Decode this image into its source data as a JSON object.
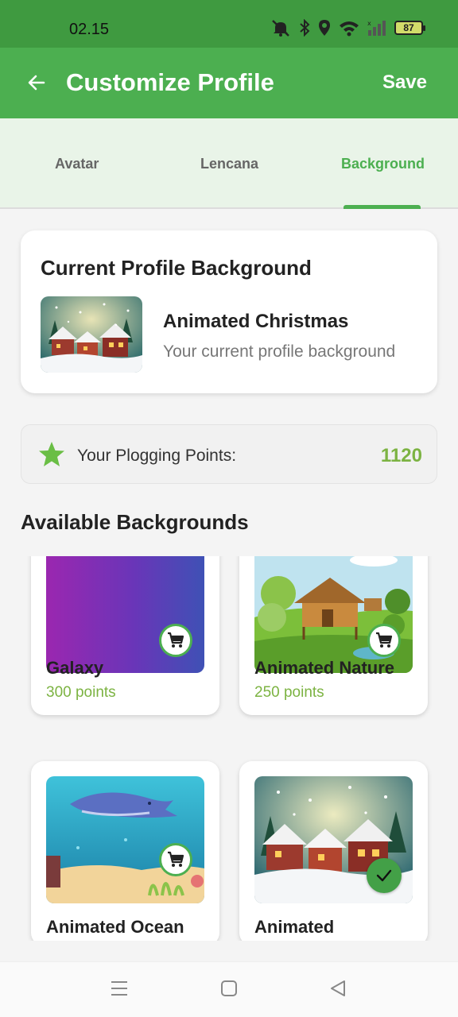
{
  "status_bar": {
    "time": "02.15",
    "battery": "87",
    "icons": [
      "mute-icon",
      "bluetooth-icon",
      "location-icon",
      "wifi-icon",
      "signal-icon",
      "battery-icon"
    ]
  },
  "app_bar": {
    "title": "Customize Profile",
    "save_label": "Save",
    "back_icon": "arrow-left-icon"
  },
  "tabs": [
    {
      "label": "Avatar",
      "active": false
    },
    {
      "label": "Lencana",
      "active": false
    },
    {
      "label": "Background",
      "active": true
    }
  ],
  "current_background": {
    "heading": "Current Profile Background",
    "name": "Animated Christmas",
    "subtitle": "Your current profile background"
  },
  "points": {
    "label": "Your Plogging Points:",
    "value": "1120"
  },
  "available": {
    "heading": "Available Backgrounds",
    "items": [
      {
        "name": "Galaxy",
        "price": "300 points",
        "status": "cart"
      },
      {
        "name": "Animated Nature",
        "price": "250 points",
        "status": "cart"
      },
      {
        "name": "Animated Ocean",
        "price": "",
        "status": "cart"
      },
      {
        "name": "Animated",
        "price": "",
        "status": "owned"
      }
    ]
  },
  "colors": {
    "primary": "#4caf50",
    "status_bar": "#3f9a40",
    "points_green": "#7cb342",
    "tab_bg": "#e9f4e8"
  },
  "nav_bar": [
    "menu-icon",
    "home-icon",
    "back-icon"
  ]
}
